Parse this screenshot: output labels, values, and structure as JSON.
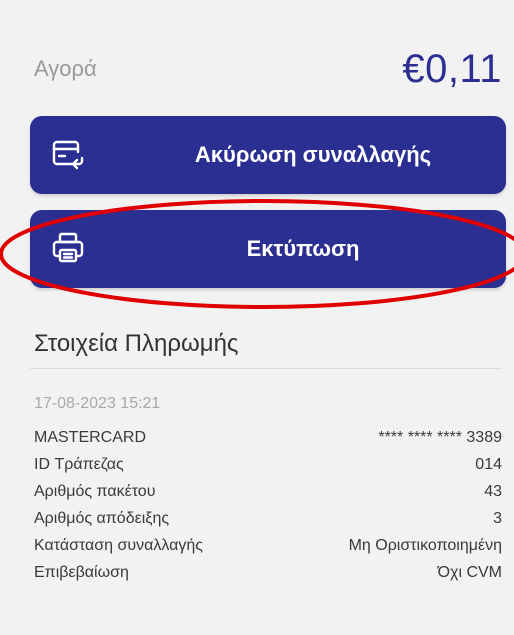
{
  "purchase": {
    "label": "Αγορά",
    "amount": "€0,11"
  },
  "actions": {
    "cancel_label": "Ακύρωση συναλλαγής",
    "print_label": "Εκτύπωση"
  },
  "payment_details": {
    "title": "Στοιχεία Πληρωμής",
    "date": "17-08-2023 15:21",
    "rows": [
      {
        "label": "MASTERCARD",
        "value": "**** **** **** 3389"
      },
      {
        "label": "ID Τράπεζας",
        "value": "014"
      },
      {
        "label": "Αριθμός πακέτου",
        "value": "43"
      },
      {
        "label": "Αριθμός απόδειξης",
        "value": "3"
      },
      {
        "label": "Κατάσταση συναλλαγής",
        "value": "Μη Οριστικοποιημένη"
      },
      {
        "label": "Επιβεβαίωση",
        "value": "Όχι CVM"
      }
    ]
  },
  "colors": {
    "brand": "#2b2f92",
    "annotation": "#e00000"
  },
  "icons": {
    "cancel": "card-refund-icon",
    "print": "printer-icon"
  }
}
